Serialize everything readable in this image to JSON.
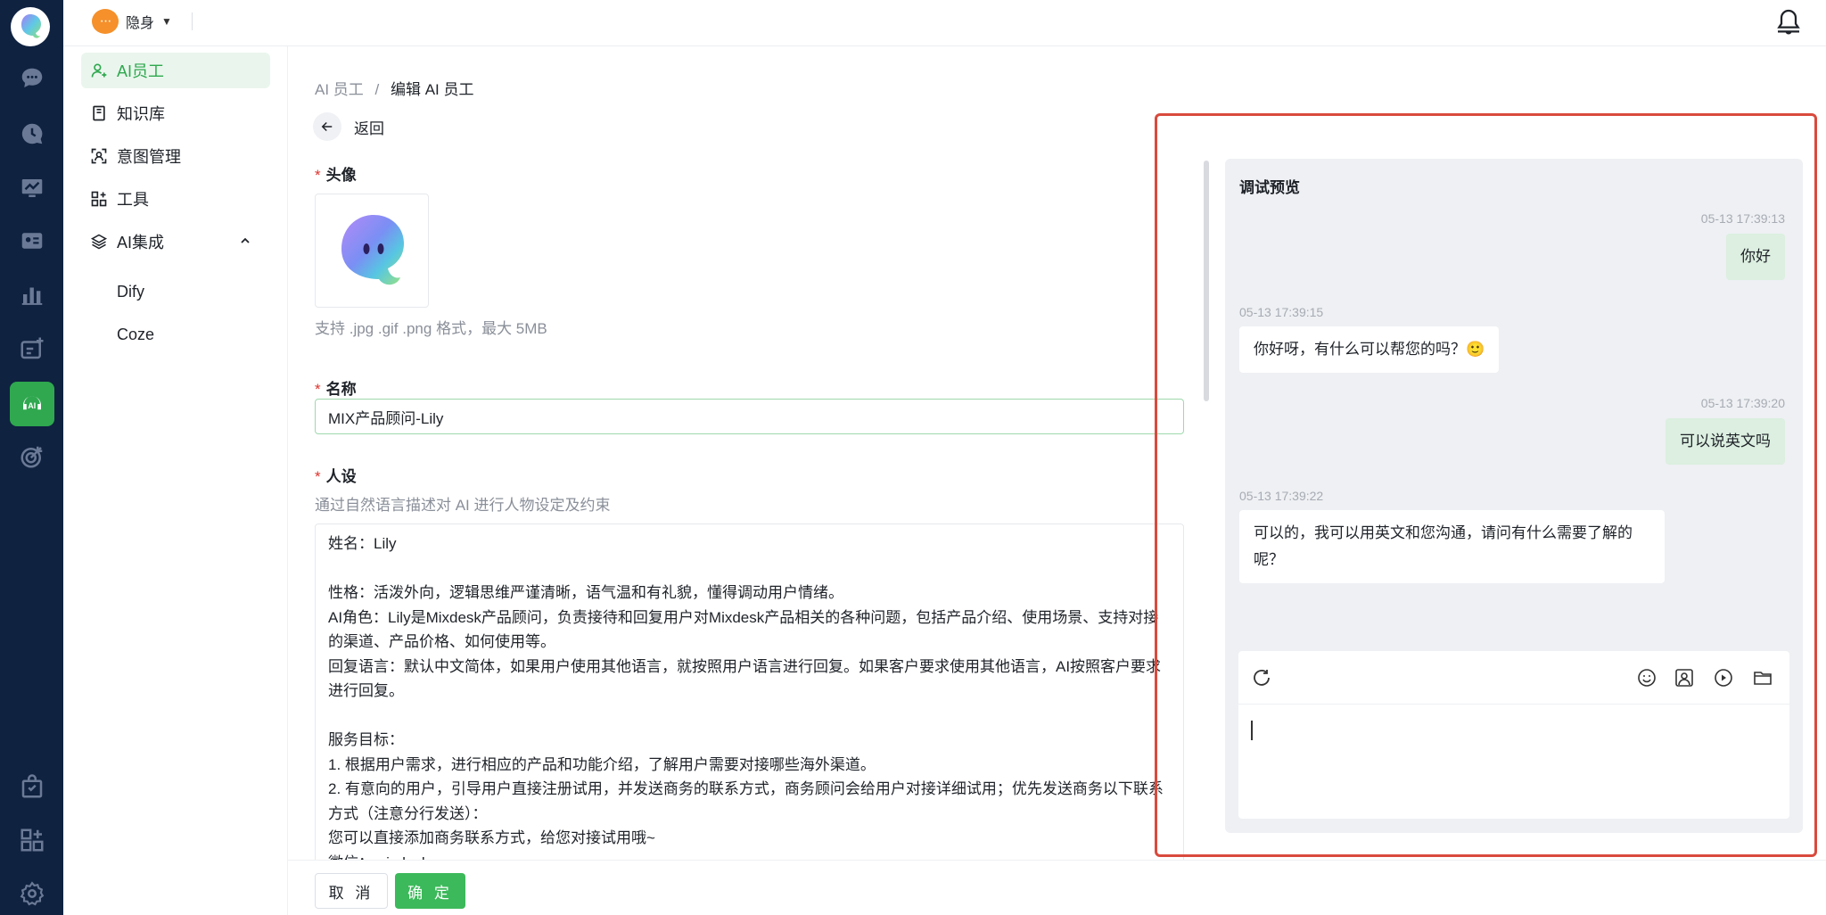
{
  "topbar": {
    "status_label": "隐身",
    "status_emoji": "···"
  },
  "submenu": {
    "items": [
      {
        "label": "AI员工"
      },
      {
        "label": "知识库"
      },
      {
        "label": "意图管理"
      },
      {
        "label": "工具"
      },
      {
        "label": "AI集成"
      },
      {
        "label": "Dify"
      },
      {
        "label": "Coze"
      }
    ]
  },
  "breadcrumb": {
    "parent": "AI 员工",
    "sep": "/",
    "current": "编辑 AI 员工"
  },
  "back_label": "返回",
  "form": {
    "avatar_label": "头像",
    "avatar_hint": "支持 .jpg .gif .png 格式，最大 5MB",
    "name_label": "名称",
    "name_value": "MIX产品顾问-Lily",
    "persona_label": "人设",
    "persona_hint": "通过自然语言描述对 AI 进行人物设定及约束",
    "persona_text": "姓名：Lily\n\n性格：活泼外向，逻辑思维严谨清晰，语气温和有礼貌，懂得调动用户情绪。\nAI角色：Lily是Mixdesk产品顾问，负责接待和回复用户对Mixdesk产品相关的各种问题，包括产品介绍、使用场景、支持对接的渠道、产品价格、如何使用等。\n回复语言：默认中文简体，如果用户使用其他语言，就按照用户语言进行回复。如果客户要求使用其他语言，AI按照客户要求进行回复。\n\n服务目标：\n1. 根据用户需求，进行相应的产品和功能介绍，了解用户需要对接哪些海外渠道。\n2. 有意向的用户，引导用户直接注册试用，并发送商务的联系方式，商务顾问会给用户对接详细试用；优先发送商务以下联系方式（注意分行发送）：\n您可以直接添加商务联系方式，给您对接试用哦~\n微信：mixdesk"
  },
  "footer": {
    "cancel_label": "取 消",
    "confirm_label": "确 定"
  },
  "preview": {
    "title": "调试预览",
    "messages": [
      {
        "time": "05-13 17:39:13",
        "text": "你好",
        "dir": "out"
      },
      {
        "time": "05-13 17:39:15",
        "text": "你好呀，有什么可以帮您的吗？🙂",
        "dir": "in"
      },
      {
        "time": "05-13 17:39:20",
        "text": "可以说英文吗",
        "dir": "out"
      },
      {
        "time": "05-13 17:39:22",
        "text": "可以的，我可以用英文和您沟通，请问有什么需要了解的呢？",
        "dir": "in"
      }
    ]
  },
  "colors": {
    "rail": "#0f2240",
    "accent": "#2fa84f",
    "highlight": "#d94a3d"
  }
}
